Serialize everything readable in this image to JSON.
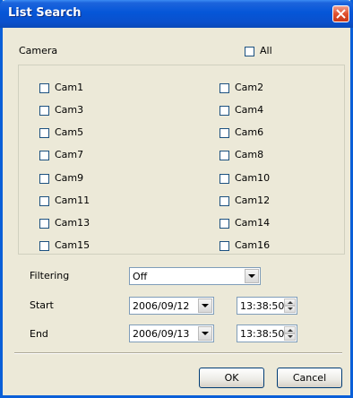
{
  "window": {
    "title": "List Search"
  },
  "camera_header": {
    "label": "Camera",
    "all_label": "All",
    "all_checked": false
  },
  "cameras": {
    "left": [
      "Cam1",
      "Cam3",
      "Cam5",
      "Cam7",
      "Cam9",
      "Cam11",
      "Cam13",
      "Cam15"
    ],
    "right": [
      "Cam2",
      "Cam4",
      "Cam6",
      "Cam8",
      "Cam10",
      "Cam12",
      "Cam14",
      "Cam16"
    ]
  },
  "filtering": {
    "label": "Filtering",
    "value": "Off"
  },
  "start": {
    "label": "Start",
    "date": "2006/09/12",
    "time": "13:38:50"
  },
  "end": {
    "label": "End",
    "date": "2006/09/13",
    "time": "13:38:50"
  },
  "buttons": {
    "ok": "OK",
    "cancel": "Cancel"
  },
  "colors": {
    "title_bar": "#0556d8",
    "dialog_bg": "#ece9d8",
    "close_button": "#e0502e"
  },
  "icons": {
    "close": "close-icon",
    "dropdown": "chevron-down-icon",
    "spin_up": "chevron-up-icon",
    "spin_down": "chevron-down-icon"
  }
}
